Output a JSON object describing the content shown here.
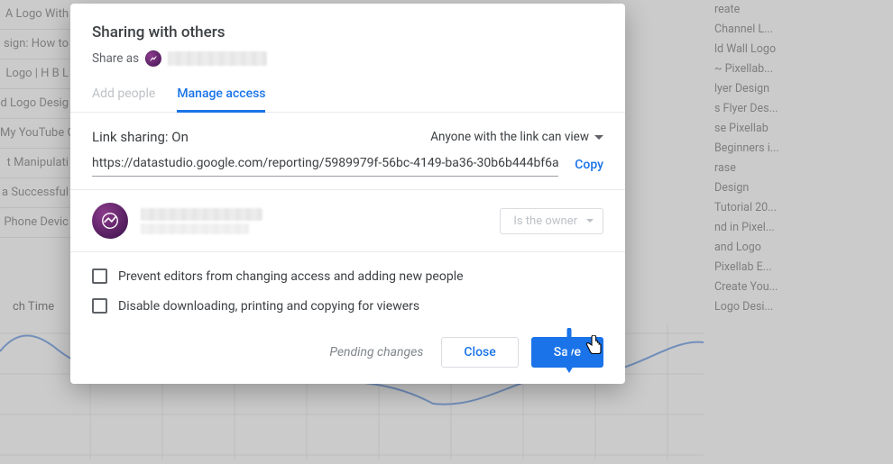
{
  "background": {
    "left_items": [
      "A Logo With",
      "sign: How to",
      "Logo | H B L",
      "d Logo Desig",
      "My YouTube C",
      "t Manipulati",
      "a Successful",
      "Phone Devic"
    ],
    "right_items": [
      "reate",
      "Channel L...",
      "ld Wall Logo",
      "~ Pixellab...",
      "lyer Design",
      "s Flyer Des...",
      "se Pixellab",
      "Beginners i...",
      "rase",
      "Design",
      "Tutorial 20...",
      "nd in Pixel...",
      "and Logo",
      "Pixellab E...",
      "Create You...",
      "Logo Desi..."
    ],
    "watch_label": "ch Time"
  },
  "modal": {
    "title": "Sharing with others",
    "share_as_label": "Share as",
    "tabs": {
      "add": "Add people",
      "manage": "Manage access"
    },
    "link_sharing_label": "Link sharing: On",
    "permission_label": "Anyone with the link can view",
    "share_url": "https://datastudio.google.com/reporting/5989979f-56bc-4149-ba36-30b6b444bf6a",
    "copy_label": "Copy",
    "owner_role": "Is the owner",
    "option_prevent": "Prevent editors from changing access and adding new people",
    "option_disable": "Disable downloading, printing and copying for viewers",
    "pending": "Pending changes",
    "close_label": "Close",
    "save_label": "Save"
  },
  "colors": {
    "accent": "#1a73e8"
  }
}
